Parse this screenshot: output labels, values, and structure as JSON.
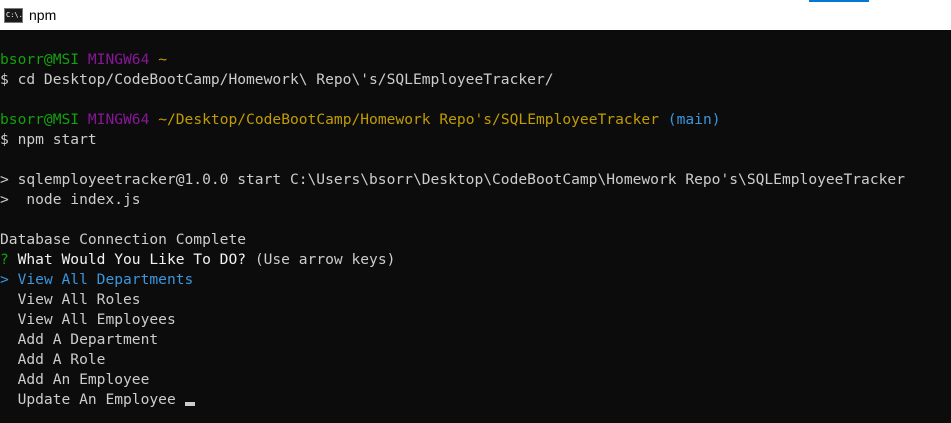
{
  "window": {
    "title": "npm",
    "icon": "terminal-app-icon",
    "icon_text": "C:\\."
  },
  "colors": {
    "background": "#0c0c0c",
    "text": "#cccccc",
    "prompt_user": "#13a10e",
    "prompt_system": "#881798",
    "prompt_path": "#c19c00",
    "branch": "#3a96dd",
    "selected": "#3a96dd"
  },
  "terminal": {
    "prompt1": {
      "user": "bsorr@MSI",
      "system": "MINGW64",
      "path": "~"
    },
    "cmd1": "$ cd Desktop/CodeBootCamp/Homework\\ Repo\\'s/SQLEmployeeTracker/",
    "prompt2": {
      "user": "bsorr@MSI",
      "system": "MINGW64",
      "path": "~/Desktop/CodeBootCamp/Homework Repo's/SQLEmployeeTracker",
      "branch": "(main)"
    },
    "cmd2": "$ npm start",
    "npm_line1": "> sqlemployeetracker@1.0.0 start C:\\Users\\bsorr\\Desktop\\CodeBootCamp\\Homework Repo's\\SQLEmployeeTracker",
    "npm_line2": ">  node index.js",
    "status": "Database Connection Complete",
    "question_mark": "?",
    "question": " What Would You Like To DO?",
    "hint": " (Use arrow keys)",
    "pointer": ">",
    "options": [
      "View All Departments",
      "View All Roles",
      "View All Employees",
      "Add A Department",
      "Add A Role",
      "Add An Employee",
      "Update An Employee"
    ],
    "selected_index": 0
  }
}
